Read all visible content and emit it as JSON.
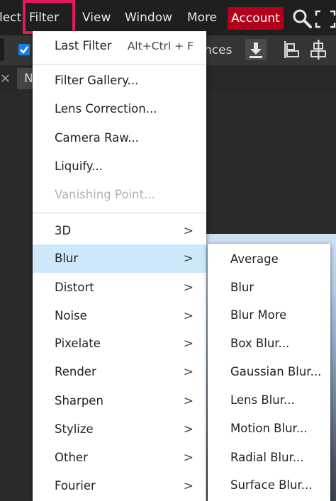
{
  "menubar": {
    "items": [
      {
        "label": "lect"
      },
      {
        "label": "Filter"
      },
      {
        "label": "View"
      },
      {
        "label": "Window"
      },
      {
        "label": "More"
      }
    ],
    "account_label": "Account",
    "icons": [
      "search-icon",
      "fullscreen-icon"
    ]
  },
  "optionsbar": {
    "partial_text": "nces",
    "checkbox_checked": true
  },
  "tabs": {
    "close_glyph": "×",
    "doc_tab_label": "N"
  },
  "filter_menu": {
    "last_filter": {
      "label": "Last Filter",
      "shortcut": "Alt+Ctrl + F"
    },
    "group1": [
      {
        "label": "Filter Gallery...",
        "disabled": false
      },
      {
        "label": "Lens Correction...",
        "disabled": false
      },
      {
        "label": "Camera Raw...",
        "disabled": false
      },
      {
        "label": "Liquify...",
        "disabled": false
      },
      {
        "label": "Vanishing Point...",
        "disabled": true
      }
    ],
    "group2": [
      {
        "label": "3D",
        "arrow": ">"
      },
      {
        "label": "Blur",
        "arrow": ">",
        "highlighted": true
      },
      {
        "label": "Distort",
        "arrow": ">"
      },
      {
        "label": "Noise",
        "arrow": ">"
      },
      {
        "label": "Pixelate",
        "arrow": ">"
      },
      {
        "label": "Render",
        "arrow": ">"
      },
      {
        "label": "Sharpen",
        "arrow": ">"
      },
      {
        "label": "Stylize",
        "arrow": ">"
      },
      {
        "label": "Other",
        "arrow": ">"
      },
      {
        "label": "Fourier",
        "arrow": ">"
      }
    ]
  },
  "blur_submenu": {
    "items": [
      "Average",
      "Blur",
      "Blur More",
      "Box Blur...",
      "Gaussian Blur...",
      "Lens Blur...",
      "Motion Blur...",
      "Radial Blur...",
      "Surface Blur..."
    ]
  },
  "colors": {
    "highlight_box": "#e6195e",
    "account_bg": "#b3001b",
    "hover_row": "#cde8fb"
  }
}
